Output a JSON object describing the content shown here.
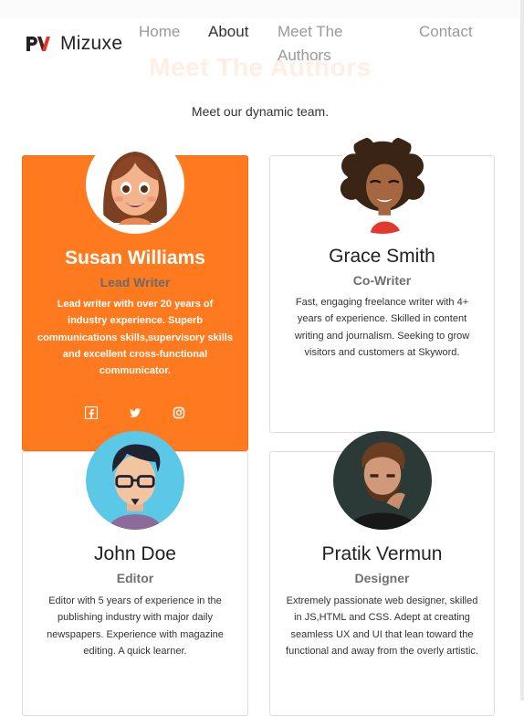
{
  "brand": {
    "name": "Mizuxe",
    "logo_icon": "pv-logo-icon"
  },
  "nav": {
    "items": [
      {
        "label": "Home",
        "active": false
      },
      {
        "label": "About",
        "active": true
      },
      {
        "label": "Meet The Authors",
        "active": false
      },
      {
        "label": "Contact",
        "active": false
      }
    ]
  },
  "section": {
    "title": "Meet The Authors",
    "subtitle": "Meet our dynamic team."
  },
  "authors": [
    {
      "name": "Susan Williams",
      "role": "Lead Writer",
      "description": "Lead writer with over 20 years of industry experience. Superb communications skills,supervisory skills and excellent cross-functional communicator.",
      "avatar": "woman-cartoon-avatar",
      "featured": true,
      "social_icons": [
        "facebook-icon",
        "twitter-icon",
        "instagram-icon"
      ]
    },
    {
      "name": "Grace Smith",
      "role": "Co-Writer",
      "description": "Fast, engaging freelance writer with 4+ years of experience. Skilled in content writing and journalism. Seeking to grow visitors and customers at Skyword.",
      "avatar": "curly-hair-woman-avatar",
      "featured": false
    },
    {
      "name": "John Doe",
      "role": "Editor",
      "description": "Editor with 5 years of experience in the publishing industry with major daily newspapers. Experience with magazine editing. A quick learner.",
      "avatar": "glasses-man-avatar",
      "featured": false
    },
    {
      "name": "Pratik Vermun",
      "role": "Designer",
      "description": "Extremely passionate web designer, skilled in JS,HTML and CSS. Adept at creating seamless UX and UI that lean toward the functional and away from the overly artistic.",
      "avatar": "bearded-man-photo",
      "featured": false
    }
  ],
  "colors": {
    "accent": "#ff7a1f",
    "brand_red": "#e6322a",
    "text": "#222222",
    "muted": "#9a9a9a"
  }
}
